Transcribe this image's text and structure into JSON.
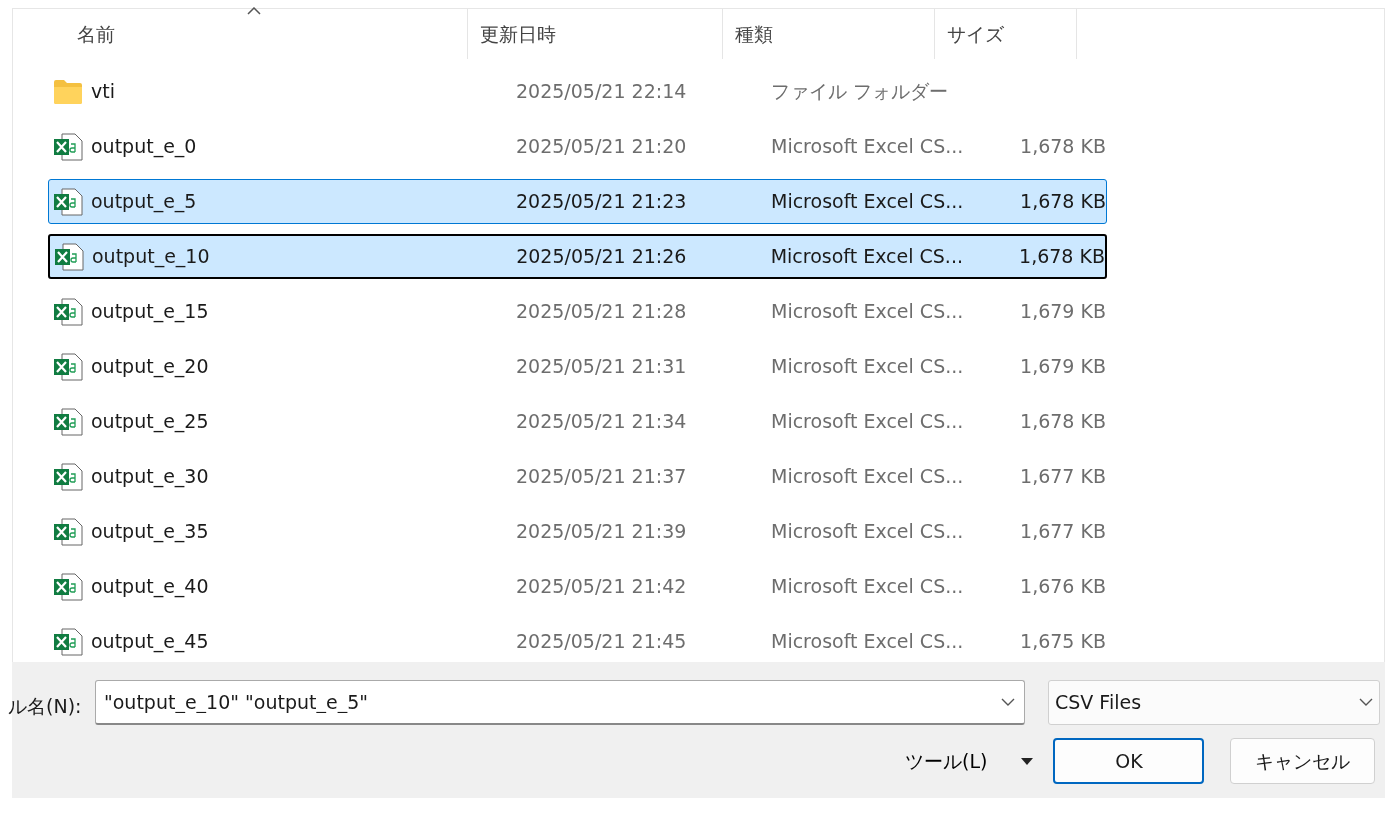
{
  "file_list": {
    "columns": [
      {
        "label": "名前"
      },
      {
        "label": "更新日時"
      },
      {
        "label": "種類"
      },
      {
        "label": "サイズ"
      }
    ],
    "rows": [
      {
        "kind": "folder",
        "name": "vti",
        "modified": "2025/05/21 22:14",
        "type": "ファイル フォルダー",
        "size": "",
        "selected": false,
        "focused": false
      },
      {
        "kind": "excel",
        "name": "output_e_0",
        "modified": "2025/05/21 21:20",
        "type": "Microsoft Excel CS...",
        "size": "1,678 KB",
        "selected": false,
        "focused": false
      },
      {
        "kind": "excel",
        "name": "output_e_5",
        "modified": "2025/05/21 21:23",
        "type": "Microsoft Excel CS...",
        "size": "1,678 KB",
        "selected": true,
        "focused": false
      },
      {
        "kind": "excel",
        "name": "output_e_10",
        "modified": "2025/05/21 21:26",
        "type": "Microsoft Excel CS...",
        "size": "1,678 KB",
        "selected": true,
        "focused": true
      },
      {
        "kind": "excel",
        "name": "output_e_15",
        "modified": "2025/05/21 21:28",
        "type": "Microsoft Excel CS...",
        "size": "1,679 KB",
        "selected": false,
        "focused": false
      },
      {
        "kind": "excel",
        "name": "output_e_20",
        "modified": "2025/05/21 21:31",
        "type": "Microsoft Excel CS...",
        "size": "1,679 KB",
        "selected": false,
        "focused": false
      },
      {
        "kind": "excel",
        "name": "output_e_25",
        "modified": "2025/05/21 21:34",
        "type": "Microsoft Excel CS...",
        "size": "1,678 KB",
        "selected": false,
        "focused": false
      },
      {
        "kind": "excel",
        "name": "output_e_30",
        "modified": "2025/05/21 21:37",
        "type": "Microsoft Excel CS...",
        "size": "1,677 KB",
        "selected": false,
        "focused": false
      },
      {
        "kind": "excel",
        "name": "output_e_35",
        "modified": "2025/05/21 21:39",
        "type": "Microsoft Excel CS...",
        "size": "1,677 KB",
        "selected": false,
        "focused": false
      },
      {
        "kind": "excel",
        "name": "output_e_40",
        "modified": "2025/05/21 21:42",
        "type": "Microsoft Excel CS...",
        "size": "1,676 KB",
        "selected": false,
        "focused": false
      },
      {
        "kind": "excel",
        "name": "output_e_45",
        "modified": "2025/05/21 21:45",
        "type": "Microsoft Excel CS...",
        "size": "1,675 KB",
        "selected": false,
        "focused": false
      }
    ]
  },
  "footer": {
    "filename_label": "ル名(N):",
    "filename_value": "\"output_e_10\" \"output_e_5\"",
    "filter": "CSV Files",
    "tools": "ツール(L)",
    "ok": "OK",
    "cancel": "キャンセル"
  }
}
